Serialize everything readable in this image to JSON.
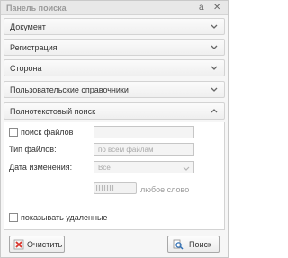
{
  "panel": {
    "title": "Панель поиска",
    "pin_glyph": "a",
    "close_glyph": "✕"
  },
  "sections": [
    {
      "label": "Документ",
      "expanded": false
    },
    {
      "label": "Регистрация",
      "expanded": false
    },
    {
      "label": "Сторона",
      "expanded": false
    },
    {
      "label": "Пользовательские справочники",
      "expanded": false
    },
    {
      "label": "Полнотекстовый поиск",
      "expanded": true
    }
  ],
  "fulltext": {
    "file_search_label": "поиск файлов",
    "file_search_checked": false,
    "file_search_value": "",
    "file_type_label": "Тип файлов:",
    "file_type_value": "по всем файлам",
    "date_changed_label": "Дата изменения:",
    "date_changed_value": "Все",
    "any_word_label": "любое слово"
  },
  "show_deleted": {
    "label": "показывать удаленные",
    "checked": false
  },
  "buttons": {
    "clear_label": "Очистить",
    "search_label": "Поиск"
  },
  "colors": {
    "clear_icon": "#d9342b",
    "search_icon": "#2f6fb5"
  }
}
